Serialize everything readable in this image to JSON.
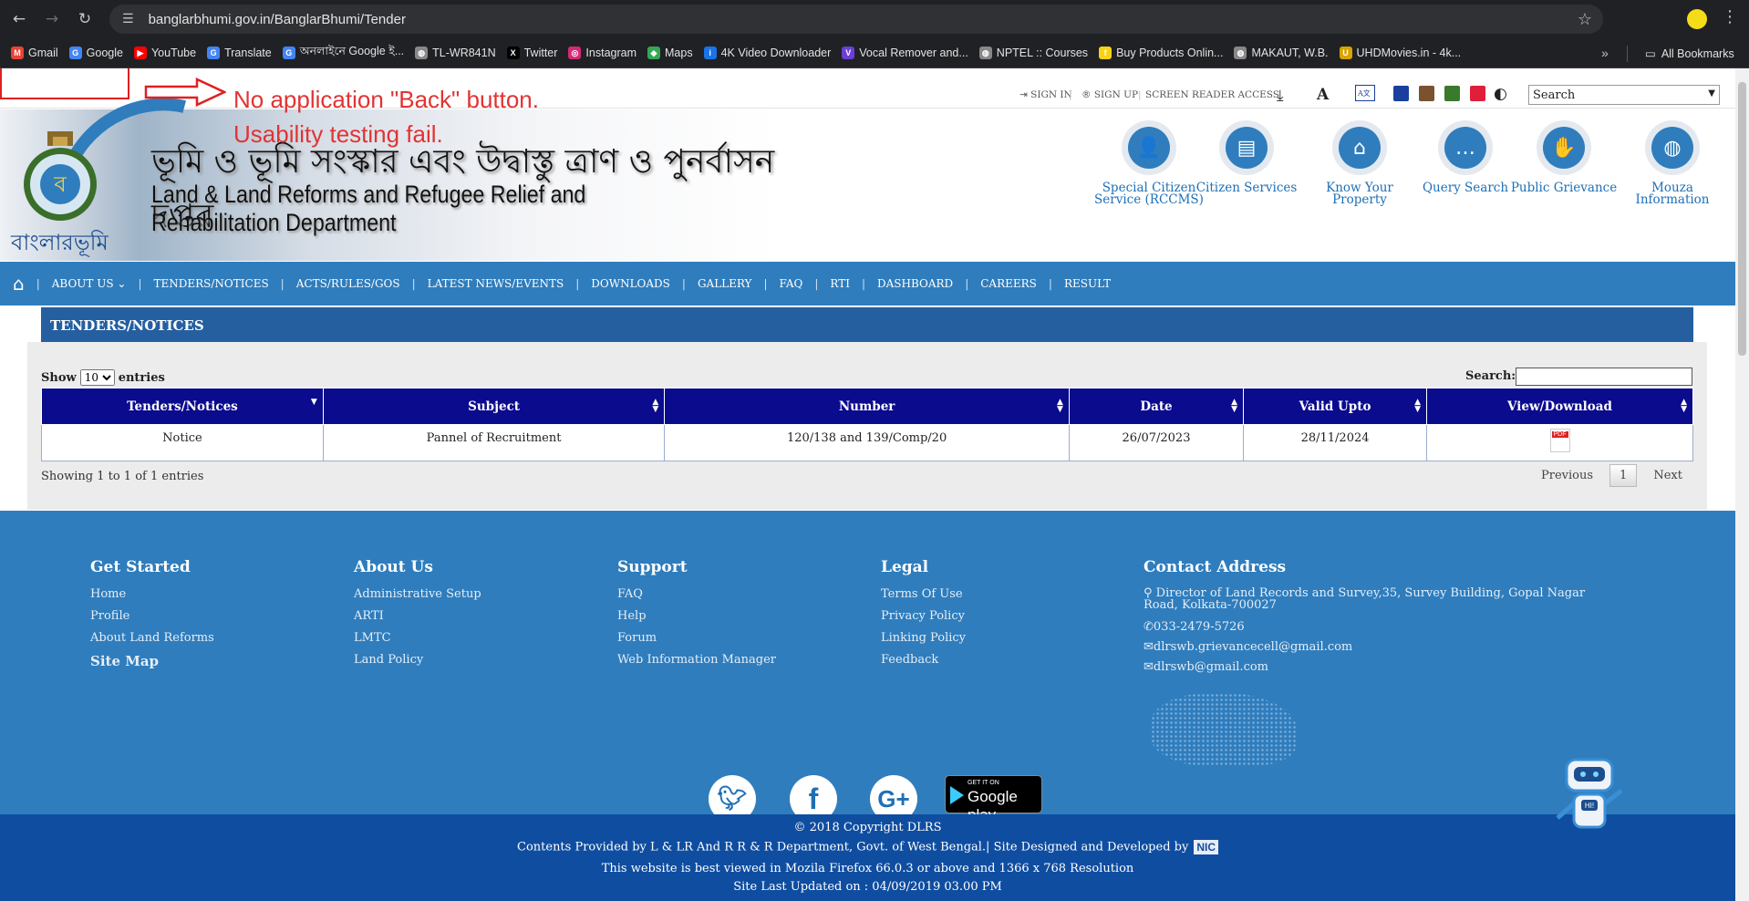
{
  "browser": {
    "url": "banglarbhumi.gov.in/BanglarBhumi/Tender",
    "bookmarks": [
      {
        "label": "Gmail",
        "icon": "gmail-icon",
        "color": "#ea4335",
        "glyph": "M"
      },
      {
        "label": "Google",
        "icon": "google-icon",
        "color": "#4285f4",
        "glyph": "G"
      },
      {
        "label": "YouTube",
        "icon": "youtube-icon",
        "color": "#ff0000",
        "glyph": "▶"
      },
      {
        "label": "Translate",
        "icon": "translate-icon",
        "color": "#4285f4",
        "glyph": "G"
      },
      {
        "label": "অনলাইনে Google ই...",
        "icon": "google-icon",
        "color": "#4285f4",
        "glyph": "G"
      },
      {
        "label": "TL-WR841N",
        "icon": "globe-icon",
        "color": "#888888",
        "glyph": "◍"
      },
      {
        "label": "Twitter",
        "icon": "x-icon",
        "color": "#000000",
        "glyph": "X"
      },
      {
        "label": "Instagram",
        "icon": "instagram-icon",
        "color": "#d62976",
        "glyph": "◎"
      },
      {
        "label": "Maps",
        "icon": "maps-icon",
        "color": "#34a853",
        "glyph": "◆"
      },
      {
        "label": "4K Video Downloader",
        "icon": "downloader-icon",
        "color": "#1a73e8",
        "glyph": "i"
      },
      {
        "label": "Vocal Remover and...",
        "icon": "vocal-remover-icon",
        "color": "#6a3fd6",
        "glyph": "V"
      },
      {
        "label": "NPTEL :: Courses",
        "icon": "globe-icon",
        "color": "#888888",
        "glyph": "◍"
      },
      {
        "label": "Buy Products Onlin...",
        "icon": "flipkart-icon",
        "color": "#f7d21a",
        "glyph": "f"
      },
      {
        "label": "MAKAUT, W.B.",
        "icon": "globe-icon",
        "color": "#888888",
        "glyph": "◍"
      },
      {
        "label": "UHDMovies.in - 4k...",
        "icon": "uhd-icon",
        "color": "#d9a400",
        "glyph": "U"
      }
    ],
    "all_bookmarks": "All Bookmarks"
  },
  "annotation": {
    "line1": "No application \"Back\" button.",
    "line2": "Usability testing fail."
  },
  "util": {
    "sign_in": "SIGN IN",
    "sign_up": "SIGN UP",
    "screen_reader": "SCREEN READER ACCESS",
    "font_a": "A",
    "search_select": "Search",
    "theme_colors": [
      "#1a3f9e",
      "#7a5230",
      "#3a7a2c",
      "#e0203a"
    ]
  },
  "header": {
    "logo_text": "বাংলারভূমি",
    "dept_bengali": "ভূমি ও ভূমি সংস্কার এবং উদ্বাস্তু ত্রাণ ও পুনর্বাসন দপ্তর",
    "dept_english": "Land & Land Reforms and Refugee Relief and Rehabilitation Department",
    "services": [
      {
        "label": "Special Citizen Service (RCCMS)",
        "icon": "person-icon",
        "glyph": "👤"
      },
      {
        "label": "Citizen Services",
        "icon": "id-card-icon",
        "glyph": "▤"
      },
      {
        "label": "Know Your Property",
        "icon": "home-icon",
        "glyph": "⌂"
      },
      {
        "label": "Query Search",
        "icon": "chat-icon",
        "glyph": "…"
      },
      {
        "label": "Public Grievance",
        "icon": "hand-icon",
        "glyph": "✋"
      },
      {
        "label": "Mouza Information",
        "icon": "globe-icon",
        "glyph": "◍"
      }
    ]
  },
  "nav": {
    "items": [
      "ABOUT US",
      "TENDERS/NOTICES",
      "ACTS/RULES/GOS",
      "LATEST NEWS/EVENTS",
      "DOWNLOADS",
      "GALLERY",
      "FAQ",
      "RTI",
      "DASHBOARD",
      "CAREERS",
      "RESULT"
    ]
  },
  "content": {
    "title": "TENDERS/NOTICES",
    "show_label": "Show",
    "show_value": "10",
    "entries_label": "entries",
    "search_label": "Search:",
    "columns": [
      "Tenders/Notices",
      "Subject",
      "Number",
      "Date",
      "Valid Upto",
      "View/Download"
    ],
    "rows": [
      {
        "type": "Notice",
        "subject": "Pannel of Recruitment",
        "number": "120/138 and 139/Comp/20",
        "date": "26/07/2023",
        "valid": "28/11/2024",
        "file": "PDF"
      }
    ],
    "showing": "Showing 1 to 1 of 1 entries",
    "prev": "Previous",
    "page": "1",
    "next": "Next"
  },
  "footer": {
    "get_started": {
      "title": "Get Started",
      "items": [
        "Home",
        "Profile",
        "About Land Reforms"
      ],
      "sitemap": "Site Map"
    },
    "about": {
      "title": "About Us",
      "items": [
        "Administrative Setup",
        "ARTI",
        "LMTC",
        "Land Policy"
      ]
    },
    "support": {
      "title": "Support",
      "items": [
        "FAQ",
        "Help",
        "Forum",
        "Web Information Manager"
      ]
    },
    "legal": {
      "title": "Legal",
      "items": [
        "Terms Of Use",
        "Privacy Policy",
        "Linking Policy",
        "Feedback"
      ]
    },
    "contact": {
      "title": "Contact Address",
      "address": "Director of Land Records and Survey,35, Survey Building, Gopal Nagar Road, Kolkata-700027",
      "phone": "033-2479-5726",
      "email1": "dlrswb.grievancecell@gmail.com",
      "email2": "dlrswb@gmail.com"
    },
    "gplay_small": "GET IT ON",
    "gplay_big": "Google play",
    "bot_label": "HI!",
    "copyright": "© 2018 Copyright DLRS",
    "contents": "Contents Provided by L & LR And R R & R Department, Govt. of West Bengal.| Site Designed and Developed by",
    "nic": "NIC",
    "best_viewed": "This website is best viewed in Mozila Firefox 66.0.3 or above and 1366 x 768 Resolution",
    "last_updated": "Site Last Updated on :  04/09/2019 03.00 PM"
  }
}
